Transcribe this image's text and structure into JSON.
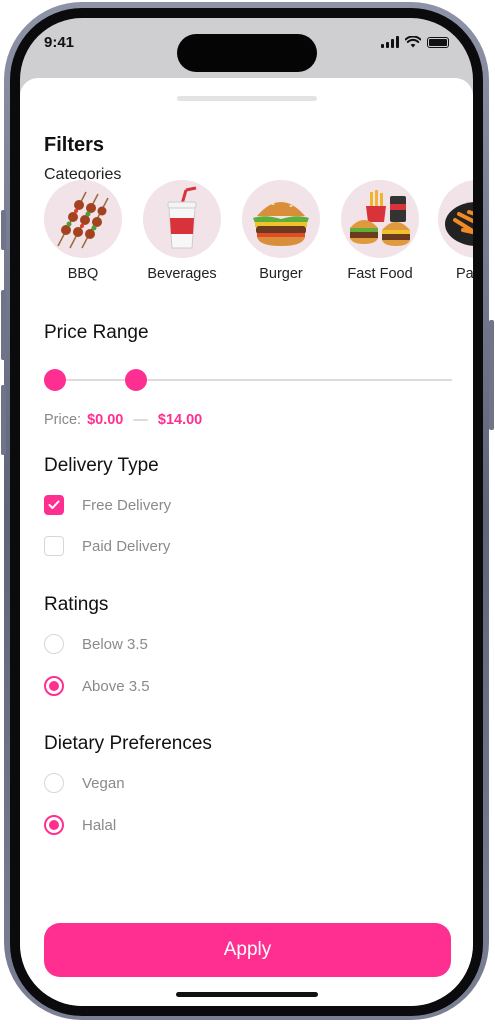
{
  "status_bar": {
    "time": "9:41"
  },
  "sheet": {
    "title": "Filters"
  },
  "categories": {
    "heading": "Categories",
    "items": [
      {
        "label": "BBQ",
        "icon": "bbq-skewers-icon"
      },
      {
        "label": "Beverages",
        "icon": "soda-cup-icon"
      },
      {
        "label": "Burger",
        "icon": "burger-icon"
      },
      {
        "label": "Fast Food",
        "icon": "fast-food-combo-icon"
      },
      {
        "label": "Pa",
        "icon": "pasta-icon"
      }
    ]
  },
  "price_range": {
    "heading": "Price Range",
    "price_label": "Price:",
    "min": "$0.00",
    "separator": "—",
    "max": "$14.00"
  },
  "delivery_type": {
    "heading": "Delivery Type",
    "options": [
      {
        "label": "Free Delivery",
        "checked": true
      },
      {
        "label": "Paid Delivery",
        "checked": false
      }
    ]
  },
  "ratings": {
    "heading": "Ratings",
    "options": [
      {
        "label": "Below 3.5",
        "selected": false
      },
      {
        "label": "Above 3.5",
        "selected": true
      }
    ]
  },
  "dietary": {
    "heading": "Dietary Preferences",
    "options": [
      {
        "label": "Vegan",
        "selected": false
      },
      {
        "label": "Halal",
        "selected": true
      }
    ]
  },
  "apply_label": "Apply",
  "colors": {
    "accent": "#ff2f92",
    "category_bg": "#f1e3e7"
  }
}
